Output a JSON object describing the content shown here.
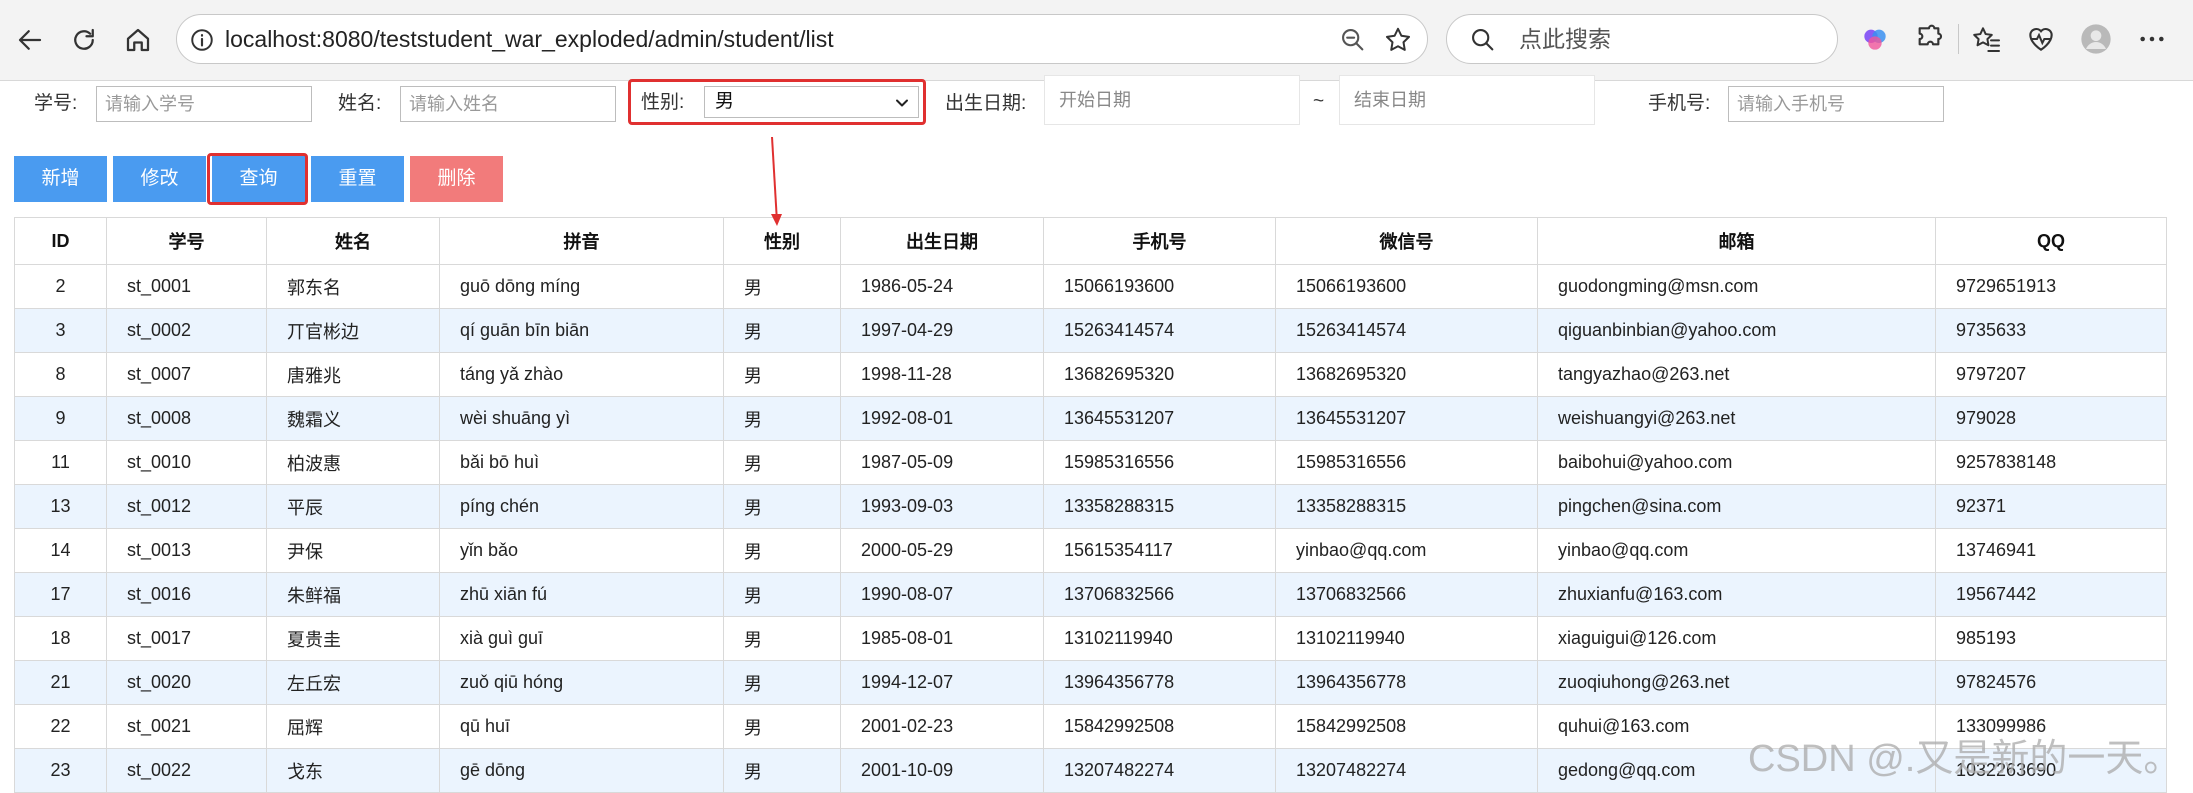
{
  "browser": {
    "url": "localhost:8080/teststudent_war_exploded/admin/student/list",
    "search_placeholder": "点此搜索"
  },
  "filters": {
    "student_no_label": "学号:",
    "student_no_placeholder": "请输入学号",
    "name_label": "姓名:",
    "name_placeholder": "请输入姓名",
    "gender_label": "性别:",
    "gender_value": "男",
    "birth_label": "出生日期:",
    "birth_start_placeholder": "开始日期",
    "range_sep": "~",
    "birth_end_placeholder": "结束日期",
    "phone_label": "手机号:",
    "phone_placeholder": "请输入手机号"
  },
  "toolbar": {
    "add_label": "新增",
    "edit_label": "修改",
    "query_label": "查询",
    "reset_label": "重置",
    "delete_label": "删除"
  },
  "table": {
    "headers": [
      "ID",
      "学号",
      "姓名",
      "拼音",
      "性别",
      "出生日期",
      "手机号",
      "微信号",
      "邮箱",
      "QQ"
    ],
    "rows": [
      [
        "2",
        "st_0001",
        "郭东名",
        "guō dōng míng",
        "男",
        "1986-05-24",
        "15066193600",
        "15066193600",
        "guodongming@msn.com",
        "9729651913"
      ],
      [
        "3",
        "st_0002",
        "丌官彬边",
        "qí guān bīn biān",
        "男",
        "1997-04-29",
        "15263414574",
        "15263414574",
        "qiguanbinbian@yahoo.com",
        "9735633"
      ],
      [
        "8",
        "st_0007",
        "唐雅兆",
        "táng yǎ zhào",
        "男",
        "1998-11-28",
        "13682695320",
        "13682695320",
        "tangyazhao@263.net",
        "9797207"
      ],
      [
        "9",
        "st_0008",
        "魏霜义",
        "wèi shuāng yì",
        "男",
        "1992-08-01",
        "13645531207",
        "13645531207",
        "weishuangyi@263.net",
        "979028"
      ],
      [
        "11",
        "st_0010",
        "柏波惠",
        "bǎi bō huì",
        "男",
        "1987-05-09",
        "15985316556",
        "15985316556",
        "baibohui@yahoo.com",
        "9257838148"
      ],
      [
        "13",
        "st_0012",
        "平辰",
        "píng chén",
        "男",
        "1993-09-03",
        "13358288315",
        "13358288315",
        "pingchen@sina.com",
        "92371"
      ],
      [
        "14",
        "st_0013",
        "尹保",
        "yǐn bǎo",
        "男",
        "2000-05-29",
        "15615354117",
        "yinbao@qq.com",
        "yinbao@qq.com",
        "13746941"
      ],
      [
        "17",
        "st_0016",
        "朱鲜福",
        "zhū xiān fú",
        "男",
        "1990-08-07",
        "13706832566",
        "13706832566",
        "zhuxianfu@163.com",
        "19567442"
      ],
      [
        "18",
        "st_0017",
        "夏贵圭",
        "xià guì guī",
        "男",
        "1985-08-01",
        "13102119940",
        "13102119940",
        "xiaguigui@126.com",
        "985193"
      ],
      [
        "21",
        "st_0020",
        "左丘宏",
        "zuǒ qiū hóng",
        "男",
        "1994-12-07",
        "13964356778",
        "13964356778",
        "zuoqiuhong@263.net",
        "97824576"
      ],
      [
        "22",
        "st_0021",
        "屈辉",
        "qū huī",
        "男",
        "2001-02-23",
        "15842992508",
        "15842992508",
        "quhui@163.com",
        "133099986"
      ],
      [
        "23",
        "st_0022",
        "戈东",
        "gē dōng",
        "男",
        "2001-10-09",
        "13207482274",
        "13207482274",
        "gedong@qq.com",
        "1032263690"
      ]
    ]
  },
  "watermark": "CSDN @.又是新的一天。",
  "colors": {
    "button_blue": "#4a9bf0",
    "button_red": "#f27b7b",
    "highlight_red": "#e03030",
    "row_stripe": "#ebf4fe"
  }
}
